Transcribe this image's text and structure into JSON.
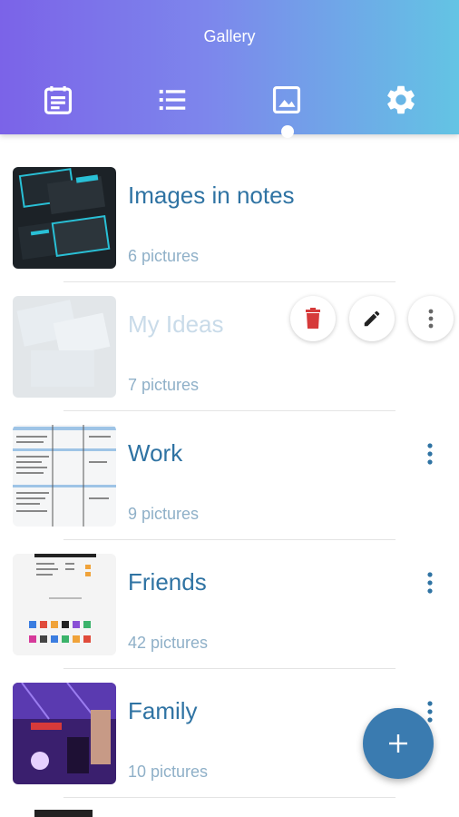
{
  "header": {
    "title": "Gallery",
    "tabs": [
      {
        "name": "calendar-notes-icon"
      },
      {
        "name": "list-icon"
      },
      {
        "name": "image-icon",
        "active": true
      },
      {
        "name": "gear-icon"
      }
    ],
    "gradient_start": "#7b63e8",
    "gradient_end": "#63c4e4"
  },
  "albums": [
    {
      "name": "Images in notes",
      "count": "6 pictures"
    },
    {
      "name": "My Ideas",
      "count": "7 pictures",
      "swiped": true
    },
    {
      "name": "Work",
      "count": "9 pictures"
    },
    {
      "name": "Friends",
      "count": "42 pictures"
    },
    {
      "name": "Family",
      "count": "10 pictures"
    }
  ],
  "swipe_actions": [
    "delete-icon",
    "edit-pencil-icon",
    "more-vertical-icon"
  ],
  "fab": {
    "icon": "plus-icon"
  },
  "colors": {
    "accent": "#2f73a3",
    "muted": "#8fb0c8",
    "delete": "#d63a3a",
    "fab": "#3a7bb0"
  }
}
